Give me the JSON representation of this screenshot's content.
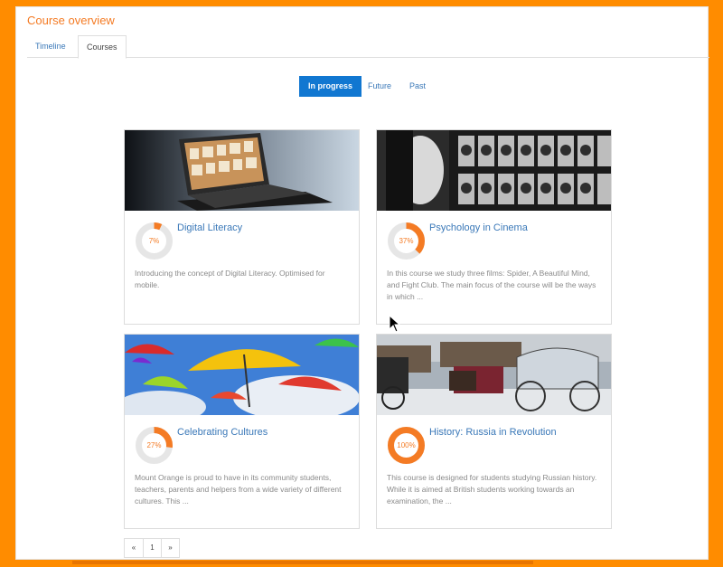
{
  "page": {
    "title": "Course overview",
    "accent_color": "#f47b24",
    "frame_color": "#ff8c00"
  },
  "tabs": [
    {
      "label": "Timeline",
      "active": false
    },
    {
      "label": "Courses",
      "active": true
    }
  ],
  "filters": [
    {
      "label": "In progress",
      "active": true
    },
    {
      "label": "Future",
      "active": false
    },
    {
      "label": "Past",
      "active": false
    }
  ],
  "courses": [
    {
      "title": "Digital Literacy",
      "progress_text": "7%",
      "progress": 7,
      "summary": "Introducing the concept of Digital Literacy. Optimised for mobile.",
      "image_icon": "laptop-bookshelf-image"
    },
    {
      "title": "Psychology in Cinema",
      "progress_text": "37%",
      "progress": 37,
      "summary": "In this course we study three films: Spider, A Beautiful Mind, and Fight Club. The main focus of the course will be the ways in which ...",
      "image_icon": "face-film-strip-image"
    },
    {
      "title": "Celebrating Cultures",
      "progress_text": "27%",
      "progress": 27,
      "summary": "Mount Orange is proud to have in its community students, teachers, parents and helpers from a wide variety of different cultures. This ...",
      "image_icon": "umbrellas-image"
    },
    {
      "title": "History: Russia in Revolution",
      "progress_text": "100%",
      "progress": 100,
      "summary": "This course is designed for students studying Russian history. While it is aimed at British students working towards an examination, the ...",
      "image_icon": "horse-carriage-image"
    }
  ],
  "pagination": {
    "prev": "«",
    "current": "1",
    "next": "»"
  }
}
